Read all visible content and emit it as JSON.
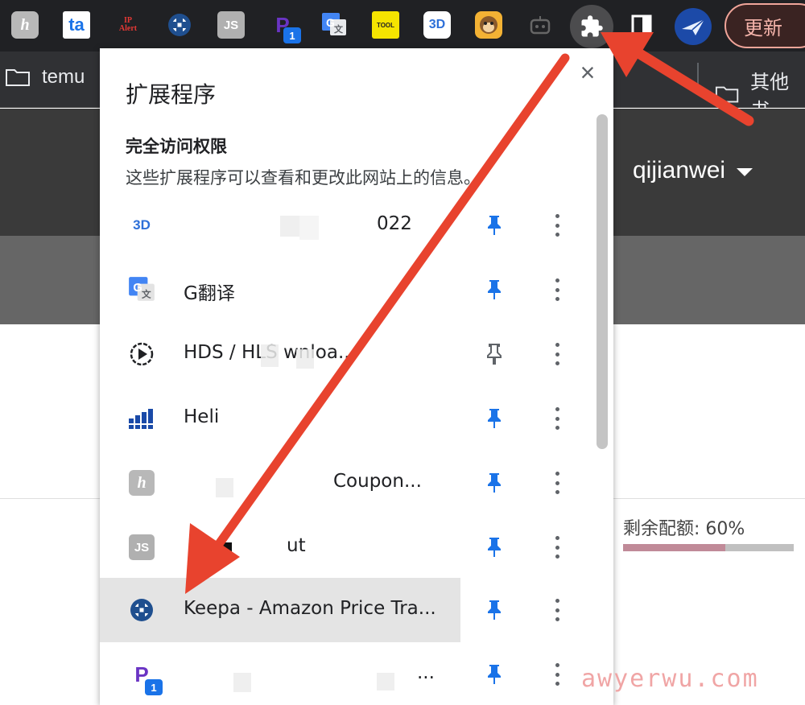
{
  "toolbar": {
    "icons": [
      {
        "name": "honey-extension-icon",
        "glyph": "h"
      },
      {
        "name": "ta-extension-icon",
        "glyph": "ta"
      },
      {
        "name": "ip-alert-extension-icon",
        "line1": "IP",
        "line2": "Alert"
      },
      {
        "name": "keepa-extension-icon"
      },
      {
        "name": "js-extension-icon",
        "glyph": "JS"
      },
      {
        "name": "p-extension-icon",
        "glyph": "P",
        "badge": "1"
      },
      {
        "name": "google-translate-icon",
        "glyph": "G"
      },
      {
        "name": "tool-extension-icon",
        "glyph": "TOOL"
      },
      {
        "name": "3d-extension-icon",
        "glyph": "3D"
      },
      {
        "name": "monkey-extension-icon"
      },
      {
        "name": "robot-extension-icon"
      },
      {
        "name": "puzzle-icon"
      },
      {
        "name": "side-panel-icon"
      },
      {
        "name": "plane-extension-icon"
      }
    ],
    "update_label": "更新"
  },
  "bookmarks": {
    "left_folder": "temu",
    "right_folder": "其他书"
  },
  "page": {
    "username": "qijianwei",
    "quota_label": "剩余配额: 60%",
    "quota_value": 0.6,
    "quota_fill_color": "#c08a98"
  },
  "popup": {
    "title": "扩展程序",
    "section_heading": "完全访问权限",
    "section_desc": "这些扩展程序可以查看和更改此网站上的信息。",
    "extensions": [
      {
        "name": "3d-extension",
        "label": "022",
        "pinned": true
      },
      {
        "name": "google-translate",
        "label": "G翻译",
        "pinned": true
      },
      {
        "name": "hds-hls-downloader",
        "label": "HDS / HLS wnloa...",
        "pinned": false
      },
      {
        "name": "helium",
        "label": "Heli",
        "pinned": true
      },
      {
        "name": "honey-coupons",
        "label": "Coupon...",
        "pinned": true
      },
      {
        "name": "js-extension",
        "label": "ut",
        "pinned": true
      },
      {
        "name": "keepa",
        "label": "Keepa - Amazon Price Tra...",
        "pinned": true,
        "selected": true
      },
      {
        "name": "p-extension",
        "label": "...",
        "pinned": true,
        "badge": "1"
      }
    ]
  },
  "colors": {
    "accent_blue": "#1a73e8",
    "arrow_red": "#e8432e",
    "toolbar_bg": "#202124"
  },
  "watermark": "awyerwu.com"
}
